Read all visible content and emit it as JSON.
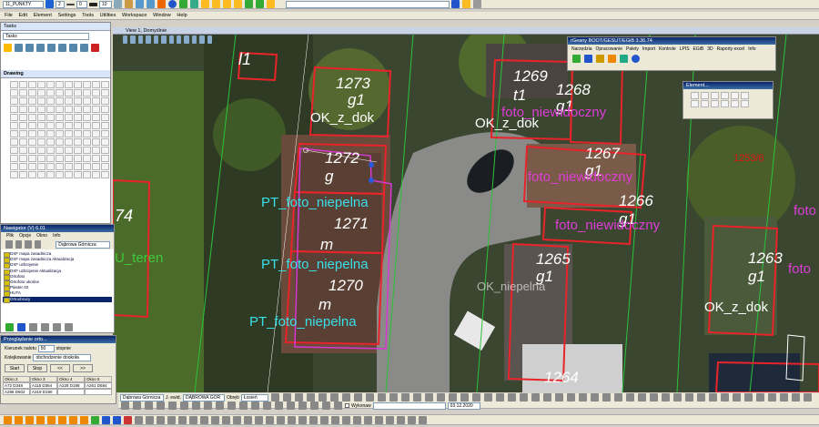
{
  "level_combo": "11_PUNKTY",
  "color_value": "2",
  "style_value": "0",
  "weight_value": "10",
  "menu": [
    "File",
    "Edit",
    "Element",
    "Settings",
    "Tools",
    "Utilities",
    "Workspace",
    "Window",
    "Help"
  ],
  "tasks": {
    "title": "Tasks",
    "combo": "Tasks",
    "drawing": "Drawing",
    "rows": [
      "",
      "",
      "W",
      "",
      "",
      "",
      "",
      "",
      "",
      "",
      "",
      "",
      ""
    ]
  },
  "view": {
    "title": "View 1, Domyślnie"
  },
  "egib": {
    "title": "rGeany BOOT/GESUT/EGiB 3.36.74",
    "menu": [
      "Narzędzia",
      "Opracowanie",
      "Palety",
      "Import",
      "Kontrole",
      "LPIS",
      "EGiB",
      "3D",
      "Raporty excel",
      "Info"
    ]
  },
  "element": {
    "title": "Element..."
  },
  "navigator": {
    "title": "Nawigator (V) 6.01",
    "menu": [
      "Plik",
      "Opcje",
      "Okno",
      "Info"
    ],
    "combo": "Dąbrowa Górnicza",
    "items": [
      "DXF mapa zasadnicza",
      "DXF mapa zasadnicza Aktualizacja",
      "DXF uzbrojenie",
      "DXF uzbrojenie Aktualizacja",
      "Ortofoto",
      "Ortofoto ukośne",
      "Plaster 02",
      "HUTA",
      "Ortoobrazy"
    ],
    "selected": 8
  },
  "przegladanie": {
    "title": "Przeglądanie orto...",
    "kierunek_label": "Kierunek nalotu",
    "kierunek_value": "50",
    "kierunek_unit": "stopnie",
    "kolej_label": "Kolejkowanie",
    "kolej_value": "obchodzenie dookoła",
    "start": "Start",
    "stop": "Stop",
    "prev": "<<",
    "next": ">>",
    "cols": [
      "Okno 2",
      "Okno 3",
      "Okno 4",
      "Okno 5"
    ],
    "row1": [
      "A72 D348",
      "A115 D364",
      "A228 D188",
      "A261 D584"
    ],
    "row2": [
      "A286 D602",
      "A319 D190",
      "",
      ""
    ]
  },
  "status": {
    "gmina": "Dąbrowa Górnicza",
    "jewid_label": "J. ewid.",
    "jewid": "DĄBROWA GÓR",
    "obreb_label": "Obręb",
    "obreb": "Łosień",
    "wykonaw": "Wykonaw",
    "date": "03.12.2020"
  },
  "map_labels": [
    {
      "t": "1273",
      "c": "pw"
    },
    {
      "t": "g1",
      "c": "pw"
    },
    {
      "t": "OK_z_dok",
      "c": "pw"
    },
    {
      "t": "1272",
      "c": "pw"
    },
    {
      "t": "g",
      "c": "pw"
    },
    {
      "t": "PT_foto_niepelna",
      "c": "pc"
    },
    {
      "t": "1271",
      "c": "pw"
    },
    {
      "t": "m",
      "c": "pw"
    },
    {
      "t": "PT_foto_niepelna",
      "c": "pc"
    },
    {
      "t": "1270",
      "c": "pw"
    },
    {
      "t": "m",
      "c": "pw"
    },
    {
      "t": "PT_foto_niepelna",
      "c": "pc"
    },
    {
      "t": "1269",
      "c": "pw"
    },
    {
      "t": "t1",
      "c": "pw"
    },
    {
      "t": "1268",
      "c": "pw"
    },
    {
      "t": "g1",
      "c": "pw"
    },
    {
      "t": "foto_niewidoczny",
      "c": "pk"
    },
    {
      "t": "OK_z_dok",
      "c": "pw"
    },
    {
      "t": "1267",
      "c": "pw"
    },
    {
      "t": "g1",
      "c": "pw"
    },
    {
      "t": "foto_niewidoczny",
      "c": "pk"
    },
    {
      "t": "1266",
      "c": "pw"
    },
    {
      "t": "g1",
      "c": "pw"
    },
    {
      "t": "foto_niewidoczny",
      "c": "pk"
    },
    {
      "t": "1253/6",
      "c": "pr"
    },
    {
      "t": "foto",
      "c": "pk"
    },
    {
      "t": "1265",
      "c": "pw"
    },
    {
      "t": "g1",
      "c": "pw"
    },
    {
      "t": "OK_niepelna",
      "c": "pw"
    },
    {
      "t": "1263",
      "c": "pw"
    },
    {
      "t": "g1",
      "c": "pw"
    },
    {
      "t": "foto",
      "c": "pk"
    },
    {
      "t": "OK_z_dok",
      "c": "pw"
    },
    {
      "t": "1264",
      "c": "pw"
    },
    {
      "t": "74",
      "c": "pw"
    },
    {
      "t": "U_teren",
      "c": "pg"
    },
    {
      "t": "l1",
      "c": "pw"
    }
  ]
}
